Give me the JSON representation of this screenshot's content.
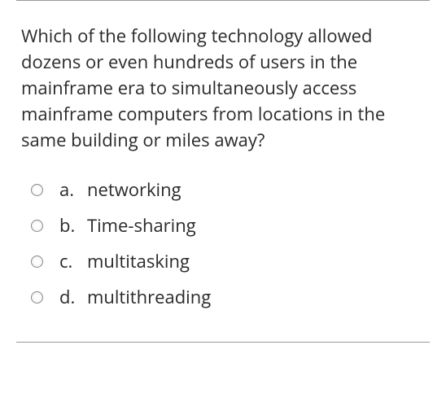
{
  "question": "Which of the following technology allowed dozens or even hundreds of users in the mainframe era to simultaneously access mainframe computers from locations in the same building or miles away?",
  "options": [
    {
      "letter": "a.",
      "text": "networking"
    },
    {
      "letter": "b.",
      "text": "Time-sharing"
    },
    {
      "letter": "c.",
      "text": "multitasking"
    },
    {
      "letter": "d.",
      "text": "multithreading"
    }
  ]
}
